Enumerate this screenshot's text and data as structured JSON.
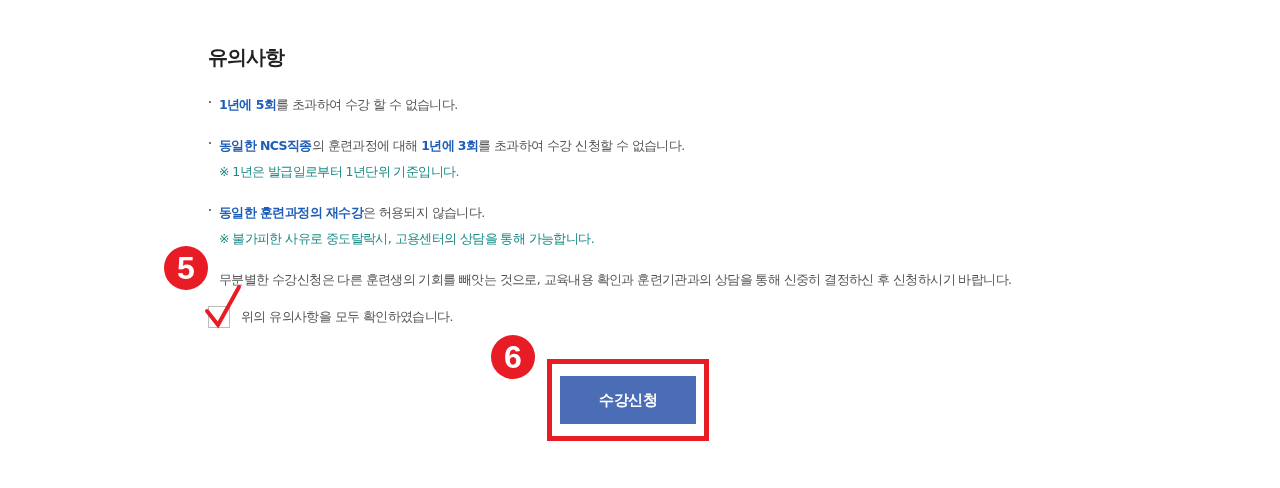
{
  "title": "유의사항",
  "items": [
    {
      "kind": "bullet",
      "text": "**1년에 5회**를 초과하여 수강 할 수 없습니다."
    },
    {
      "kind": "bullet",
      "text": "**동일한 NCS직종**의 훈련과정에 대해 **1년에 3회**를 초과하여 수강 신청할 수 없습니다."
    },
    {
      "kind": "note",
      "text": "※ 1년은 발급일로부터 1년단위 기준입니다."
    },
    {
      "kind": "bullet",
      "text": "**동일한 훈련과정의 재수강**은 허용되지 않습니다."
    },
    {
      "kind": "note",
      "text": "※ 불가피한 사유로 중도탈락시, 고용센터의 상담을 통해 가능합니다."
    },
    {
      "kind": "plain",
      "text": "무분별한 수강신청은 다른 훈련생의 기회를 빼앗는 것으로, 교육내용 확인과 훈련기관과의 상담을 통해 신중히 결정하신 후 신청하시기 바랍니다."
    }
  ],
  "agree": {
    "label": "위의 유의사항을 모두 확인하였습니다.",
    "checked": true,
    "badge": "5"
  },
  "submit": {
    "label": "수강신청",
    "badge": "6"
  }
}
